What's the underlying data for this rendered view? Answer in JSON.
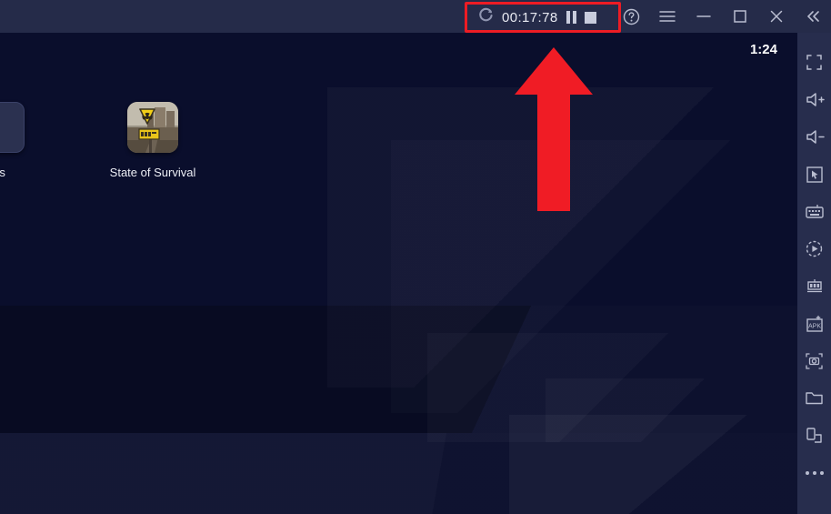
{
  "titlebar": {
    "recorder": {
      "status_icon": "recording-circle-icon",
      "timer": "00:17:78",
      "pause_label": "pause-icon",
      "stop_label": "stop-icon"
    },
    "window_controls": [
      {
        "name": "help-icon",
        "label": "?"
      },
      {
        "name": "menu-icon",
        "label": "☰"
      },
      {
        "name": "minimize-icon",
        "label": "—"
      },
      {
        "name": "maximize-icon",
        "label": "□"
      },
      {
        "name": "close-icon",
        "label": "✕"
      },
      {
        "name": "collapse-icon",
        "label": "«"
      }
    ]
  },
  "screen": {
    "status_bar": {
      "clock": "1:24"
    },
    "apps": [
      {
        "name": "state-of-survival",
        "label": "State of Survival"
      },
      {
        "name": "apps-folder",
        "label": "ps"
      }
    ]
  },
  "annotation": {
    "arrow": "red-up-arrow",
    "highlight_box": "red-highlight-rectangle",
    "color": "#ed1c24"
  },
  "sidebar": {
    "items": [
      {
        "name": "fullscreen-icon",
        "label": "Fullscreen"
      },
      {
        "name": "volume-up-icon",
        "label": "Volume up"
      },
      {
        "name": "volume-down-icon",
        "label": "Volume down"
      },
      {
        "name": "pointer-icon",
        "label": "Keymapping"
      },
      {
        "name": "keyboard-icon",
        "label": "Keyboard control"
      },
      {
        "name": "macro-record-icon",
        "label": "Macro recorder"
      },
      {
        "name": "multi-instance-icon",
        "label": "Multi-instance"
      },
      {
        "name": "install-apk-icon",
        "label": "APK"
      },
      {
        "name": "screenshot-icon",
        "label": "Screenshot"
      },
      {
        "name": "folder-icon",
        "label": "Media folder"
      },
      {
        "name": "rotate-icon",
        "label": "Rotate"
      },
      {
        "name": "more-icon",
        "label": "More"
      }
    ]
  },
  "colors": {
    "titlebar_bg": "#252b49",
    "screen_bg": "#0a0e2c",
    "sidebar_bg": "#272d4d",
    "accent_red": "#ed1c24",
    "icon_gray": "#b9bdd0"
  }
}
